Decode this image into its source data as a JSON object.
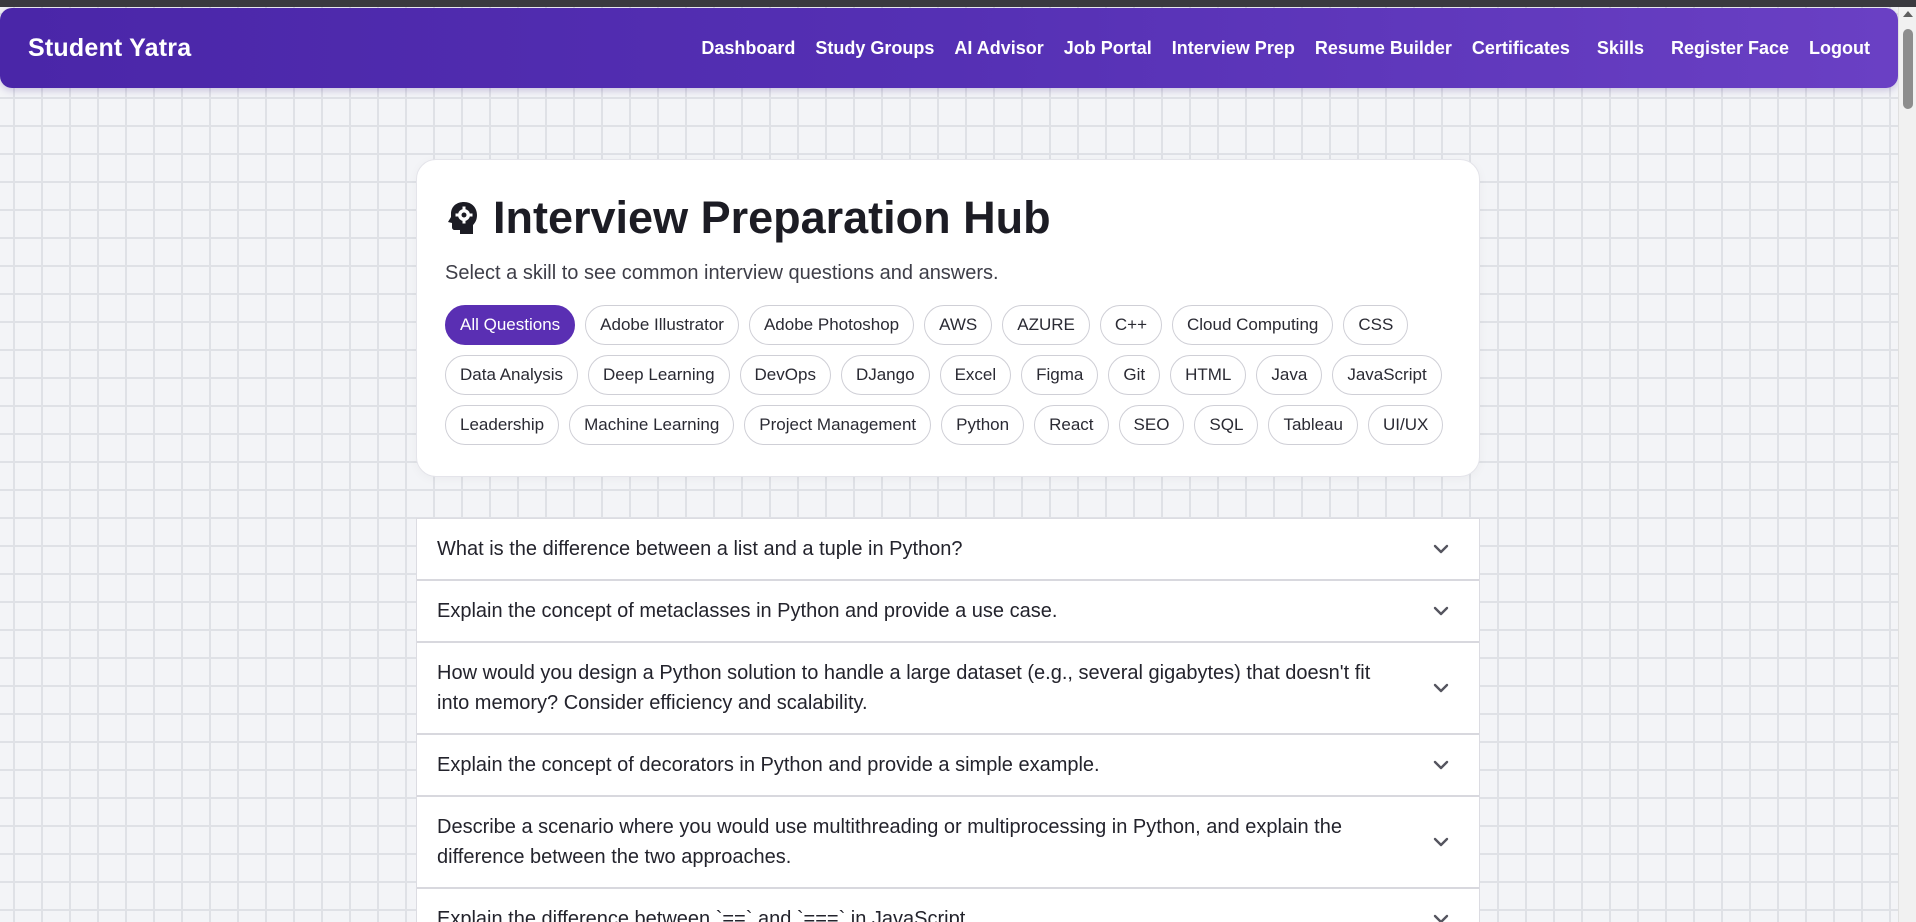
{
  "app": {
    "brand": "Student Yatra"
  },
  "nav": {
    "items": [
      {
        "label": "Dashboard"
      },
      {
        "label": "Study Groups"
      },
      {
        "label": "AI Advisor"
      },
      {
        "label": "Job Portal"
      },
      {
        "label": "Interview Prep"
      },
      {
        "label": "Resume Builder"
      },
      {
        "label": "Certificates"
      },
      {
        "label": "Skills"
      },
      {
        "label": "Register Face"
      },
      {
        "label": "Logout"
      }
    ]
  },
  "hub": {
    "icon": "brain-gear-icon",
    "title": "Interview Preparation Hub",
    "subtitle": "Select a skill to see common interview questions and answers.",
    "selected_skill": "All Questions",
    "skills": [
      "All Questions",
      "Adobe Illustrator",
      "Adobe Photoshop",
      "AWS",
      "AZURE",
      "C++",
      "Cloud Computing",
      "CSS",
      "Data Analysis",
      "Deep Learning",
      "DevOps",
      "DJango",
      "Excel",
      "Figma",
      "Git",
      "HTML",
      "Java",
      "JavaScript",
      "Leadership",
      "Machine Learning",
      "Project Management",
      "Python",
      "React",
      "SEO",
      "SQL",
      "Tableau",
      "UI/UX"
    ]
  },
  "questions": [
    {
      "text": "What is the difference between a list and a tuple in Python?"
    },
    {
      "text": "Explain the concept of metaclasses in Python and provide a use case."
    },
    {
      "text": "How would you design a Python solution to handle a large dataset (e.g., several gigabytes) that doesn't fit into memory? Consider efficiency and scalability."
    },
    {
      "text": "Explain the concept of decorators in Python and provide a simple example."
    },
    {
      "text": "Describe a scenario where you would use multithreading or multiprocessing in Python, and explain the difference between the two approaches."
    },
    {
      "text": "Explain the difference between `==` and `===` in JavaScript."
    }
  ],
  "colors": {
    "nav_gradient_start": "#4a26a8",
    "nav_gradient_end": "#6a40c4",
    "accent": "#5a2fb3",
    "background": "#f3f4f7"
  }
}
